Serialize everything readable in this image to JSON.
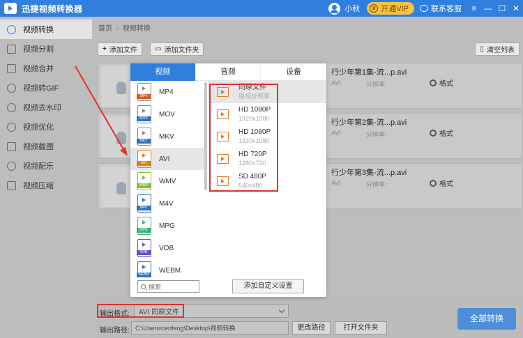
{
  "app": {
    "title": "迅捷视频转换器",
    "username": "小秋",
    "vip_label": "开通VIP",
    "support_label": "联系客服",
    "window_controls": [
      "≡",
      "—",
      "☐",
      "✕"
    ]
  },
  "sidebar": {
    "items": [
      {
        "label": "视频转换",
        "icon": "convert-icon",
        "active": true
      },
      {
        "label": "视频分割",
        "icon": "split-icon"
      },
      {
        "label": "视频合并",
        "icon": "merge-icon"
      },
      {
        "label": "视频转GIF",
        "icon": "gif-icon"
      },
      {
        "label": "视频去水印",
        "icon": "watermark-icon"
      },
      {
        "label": "视频优化",
        "icon": "optimize-icon"
      },
      {
        "label": "视频截图",
        "icon": "screenshot-icon"
      },
      {
        "label": "视频配乐",
        "icon": "music-icon"
      },
      {
        "label": "视频压缩",
        "icon": "compress-icon"
      }
    ]
  },
  "breadcrumb": {
    "home": "首页",
    "sep": "›",
    "current": "视频转换"
  },
  "toolbar": {
    "add_file": "添加文件",
    "add_folder": "添加文件夹",
    "clear_list": "清空列表"
  },
  "files": [
    {
      "name": "行少年第1集-流...p.avi",
      "meta1": "AVI",
      "meta2": "分辨率:",
      "settings": "格式"
    },
    {
      "name": "行少年第2集-流...p.avi",
      "meta1": "AVI",
      "meta2": "分辨率:",
      "settings": "格式"
    },
    {
      "name": "行少年第3集-流...p.avi",
      "meta1": "AVI",
      "meta2": "分辨率:",
      "settings": "格式"
    }
  ],
  "popup": {
    "tabs": [
      "视频",
      "音频",
      "设备"
    ],
    "formats": [
      {
        "label": "MP4",
        "color": "#e0582b"
      },
      {
        "label": "MOV",
        "color": "#2e6fc7"
      },
      {
        "label": "MKV",
        "color": "#2e6fc7"
      },
      {
        "label": "AVI",
        "color": "#e67a1e",
        "selected": true
      },
      {
        "label": "WMV",
        "color": "#7dbf3a"
      },
      {
        "label": "M4V",
        "color": "#2e6fc7"
      },
      {
        "label": "MPG",
        "color": "#3bb07a"
      },
      {
        "label": "VOB",
        "color": "#6c4ec7"
      },
      {
        "label": "WEBM",
        "color": "#2e6fc7"
      }
    ],
    "search_placeholder": "搜索",
    "resolutions": [
      {
        "title": "同原文件",
        "sub": "原视分辨率",
        "selected": true
      },
      {
        "title": "HD 1080P",
        "sub": "1920x1080"
      },
      {
        "title": "HD 1080P",
        "sub": "1920x1080"
      },
      {
        "title": "HD 720P",
        "sub": "1280x720"
      },
      {
        "title": "SD 480P",
        "sub": "640x480"
      }
    ],
    "custom_button": "添加自定义设置"
  },
  "output": {
    "format_label": "输出格式:",
    "format_value": "AVI  同原文件",
    "path_label": "输出路径:",
    "path_value": "C:\\Users\\cenfeng\\Desktop\\视频转换",
    "change_path": "更改路径",
    "open_folder": "打开文件夹",
    "convert_all": "全部转换"
  }
}
